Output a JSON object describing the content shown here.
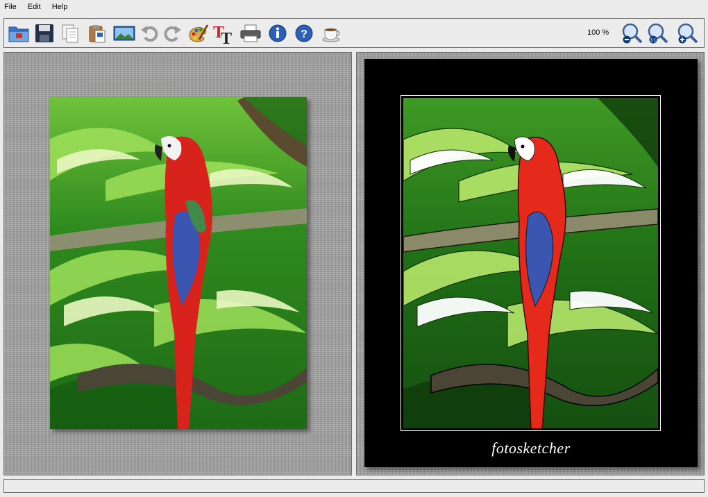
{
  "menu": [
    "File",
    "Edit",
    "Help"
  ],
  "toolbar": {
    "zoom_level": "100 %",
    "buttons": [
      "open-folder-icon",
      "save-icon",
      "copy-icon",
      "paste-icon",
      "image-icon",
      "undo-icon",
      "redo-icon",
      "palette-icon",
      "text-icon",
      "print-icon",
      "info-icon",
      "help-icon",
      "coffee-cup-icon",
      "zoom-out-icon",
      "zoom-reset-icon",
      "zoom-in-icon"
    ]
  },
  "preview": {
    "signature": "fotosketcher"
  },
  "colors": {
    "window_bg": "#ebebeb",
    "panel_bg": "#a4a4a4",
    "mat": "#000000",
    "parrot_red": "#d8231c",
    "foliage_green": "#2e8b1e"
  },
  "status": ""
}
